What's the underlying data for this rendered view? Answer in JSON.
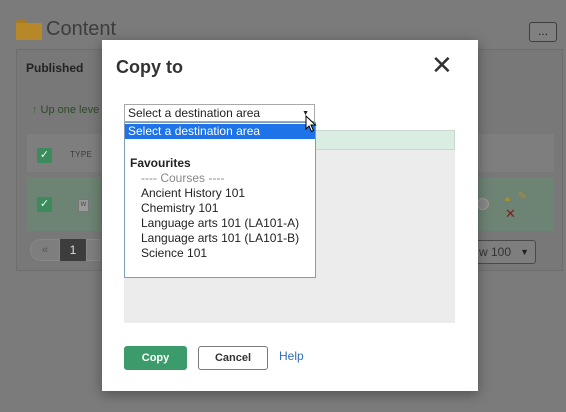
{
  "background": {
    "page_title": "Content",
    "more_button": "...",
    "tab_published": "Published",
    "up_one_level": "Up one leve",
    "type_header": "TYPE",
    "doc_icon_letter": "W",
    "pagination": {
      "current_page": "1",
      "prev": "«"
    },
    "per_page": "w 100"
  },
  "modal": {
    "title": "Copy to",
    "close_icon": "✕",
    "destination_select": {
      "value": "Select a destination area"
    },
    "dropdown_options": {
      "selected": "Select a destination area",
      "group_favourites": "Favourites",
      "courses_subheading": "---- Courses ----",
      "course_1": "Ancient History 101",
      "course_2": "Chemistry 101",
      "course_3": "Language arts 101 (LA101-A)",
      "course_4": "Language arts 101 (LA101-B)",
      "course_5": "Science 101"
    },
    "buttons": {
      "copy": "Copy",
      "cancel": "Cancel",
      "help": "Help"
    }
  },
  "colors": {
    "accent_green": "#3c9b6a",
    "selected_option_blue": "#1e73e8",
    "link_blue": "#2d6fba"
  }
}
